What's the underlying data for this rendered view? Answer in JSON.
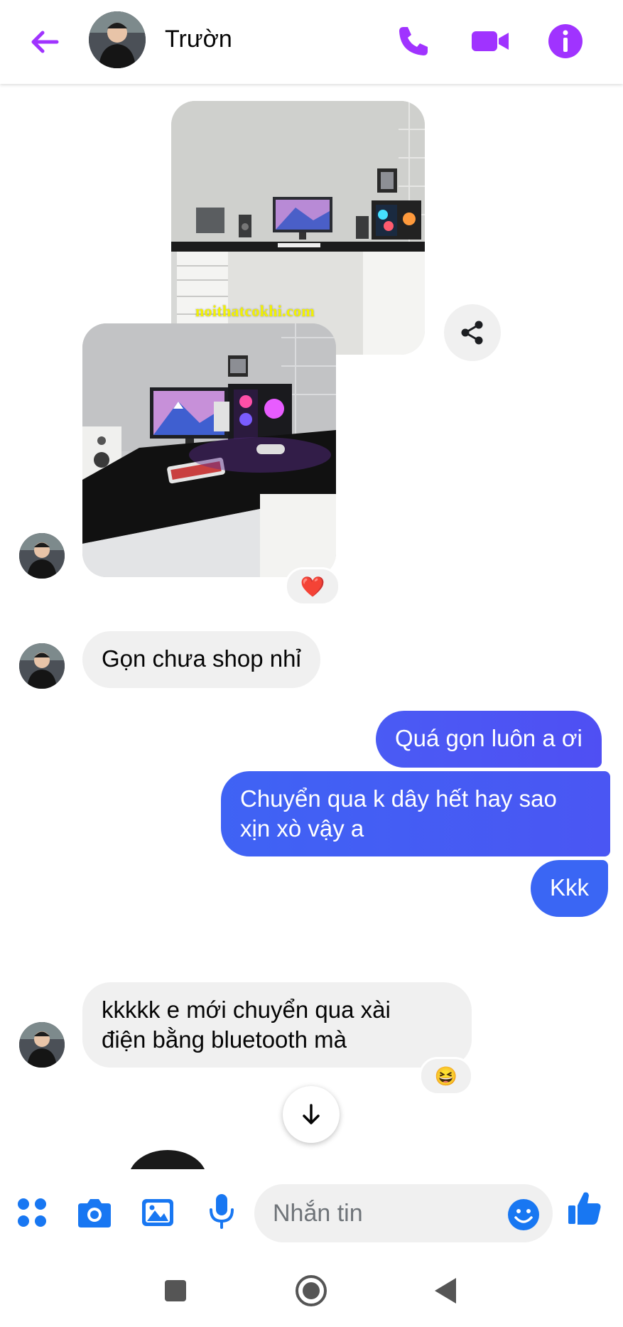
{
  "header": {
    "contact_name": "Trườn",
    "icons": [
      "back-arrow-icon",
      "phone-icon",
      "video-camera-icon",
      "info-icon"
    ],
    "accent_color": "#a033ff"
  },
  "messages": {
    "watermark": "noithatcokhi.com",
    "photo_reaction": "❤️",
    "m1": "Gọn chưa shop nhỉ",
    "m2": "Quá gọn luôn a ơi",
    "m3_line1": "Chuyển qua k dây hết hay sao",
    "m3_line2": "xịn xò vậy a",
    "m4": "Kkk",
    "m5_line1": "kkkkk e mới chuyển qua xài",
    "m5_line2": "điện bằng bluetooth mà",
    "m5_reaction": "😆",
    "incoming_bubble_color": "#f0f0f0",
    "outgoing_gradient": [
      "#3b63f4",
      "#6a3cf2"
    ]
  },
  "composer": {
    "placeholder": "Nhắn tin",
    "icons": [
      "apps-grid-icon",
      "camera-icon",
      "gallery-icon",
      "microphone-icon",
      "emoji-icon",
      "thumbs-up-icon"
    ],
    "icon_color": "#1877f2"
  },
  "navbar": {
    "icons": [
      "recent-apps-icon",
      "home-icon",
      "back-icon"
    ]
  }
}
